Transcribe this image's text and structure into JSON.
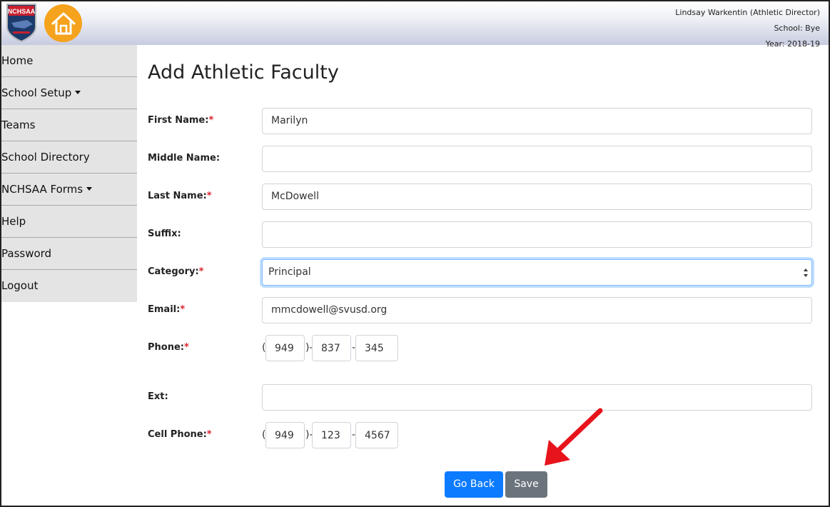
{
  "header": {
    "user_line": "Lindsay Warkentin (Athletic Director)",
    "school_line": "School: Bye",
    "year_line": "Year: 2018-19",
    "logo_icon": "nchsaa-shield-logo",
    "home_icon": "home-icon"
  },
  "sidebar": {
    "items": [
      {
        "label": "Home"
      },
      {
        "label": "School Setup"
      },
      {
        "label": "Teams"
      },
      {
        "label": "School Directory"
      },
      {
        "label": "NCHSAA Forms"
      },
      {
        "label": "Help"
      },
      {
        "label": "Password"
      },
      {
        "label": "Logout"
      }
    ]
  },
  "form": {
    "title": "Add Athletic Faculty",
    "required_mark": "*",
    "first_name": {
      "label": "First Name:",
      "value": "Marilyn"
    },
    "middle_name": {
      "label": "Middle Name:",
      "value": ""
    },
    "last_name": {
      "label": "Last Name:",
      "value": "McDowell"
    },
    "suffix": {
      "label": "Suffix:",
      "value": ""
    },
    "category": {
      "label": "Category:",
      "value": "Principal"
    },
    "email": {
      "label": "Email:",
      "value": "mmcdowell@svusd.org"
    },
    "phone": {
      "label": "Phone:",
      "area": "949",
      "prefix": "837",
      "line": "345"
    },
    "ext": {
      "label": "Ext:",
      "value": ""
    },
    "cell_phone": {
      "label": "Cell Phone:",
      "area": "949",
      "prefix": "123",
      "line": "4567"
    }
  },
  "buttons": {
    "go_back": "Go Back",
    "save": "Save"
  },
  "colors": {
    "primary": "#0d7bff",
    "secondary": "#6b747d",
    "required": "#d9242f",
    "home_orange": "#f5a21d",
    "annotation_arrow": "#e8141b"
  }
}
